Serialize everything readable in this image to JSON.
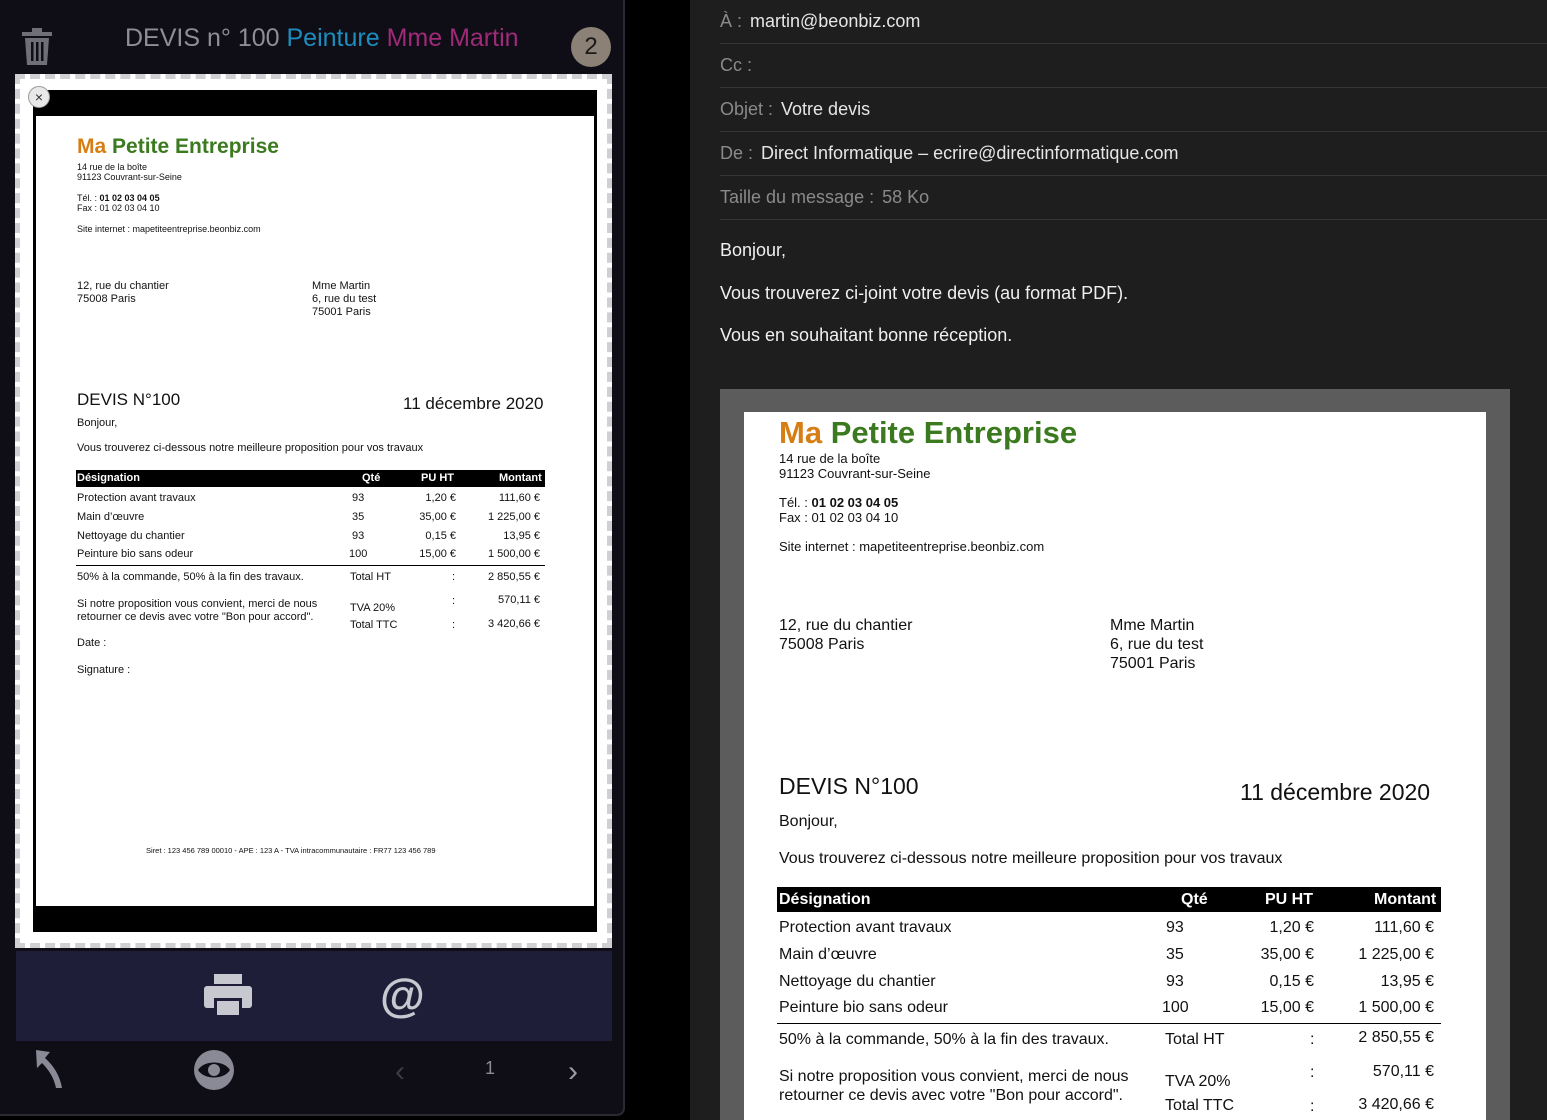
{
  "left": {
    "title_prefix": "DEVIS n° 100",
    "title_blue": "Peinture",
    "title_pink": "Mme Martin",
    "badge": "2",
    "close": "×",
    "page_number": "1",
    "at_symbol": "@"
  },
  "email": {
    "to_label": "À :",
    "to_value": "martin@beonbiz.com",
    "cc_label": "Cc :",
    "cc_value": "",
    "subject_label": "Objet :",
    "subject_value": "Votre devis",
    "from_label": "De :",
    "from_value": "Direct Informatique – ecrire@directinformatique.com",
    "size_label": "Taille du message :",
    "size_value": "58 Ko",
    "body": [
      "Bonjour,",
      "Vous trouverez ci-joint votre devis (au format PDF).",
      "Vous en souhaitant bonne réception."
    ]
  },
  "doc": {
    "brand_ma": "Ma",
    "brand_rest": "Petite Entreprise",
    "addr1": "14 rue de la boîte",
    "addr2": "91123 Couvrant-sur-Seine",
    "tel_label": "Tél. : ",
    "tel_value": "01 02 03 04 05",
    "fax": "Fax : 01 02 03 04 10",
    "site": "Site internet : mapetiteentreprise.beonbiz.com",
    "site_short": "Site internet : mapetiteentreprise.beonbiz.com",
    "chantier1": "12, rue du chantier",
    "chantier2": "75008 Paris",
    "client1": "Mme Martin",
    "client2": "6, rue du test",
    "client3": "75001 Paris",
    "devis_title": "DEVIS N°100",
    "date": "11 décembre 2020",
    "greeting": "Bonjour,",
    "intro": "Vous trouverez ci-dessous notre meilleure proposition pour vos travaux",
    "headers": [
      "Désignation",
      "Qté",
      "PU HT",
      "Montant"
    ],
    "rows": [
      [
        "Protection avant travaux",
        "93",
        "1,20 €",
        "111,60 €"
      ],
      [
        "Main d’œuvre",
        "35",
        "35,00 €",
        "1 225,00 €"
      ],
      [
        "Nettoyage du chantier",
        "93",
        "0,15 €",
        "13,95 €"
      ],
      [
        "Peinture bio sans odeur",
        "100",
        "15,00 €",
        "1 500,00 €"
      ]
    ],
    "terms": "50% à la commande, 50% à la fin des travaux.",
    "accept1": "Si notre proposition vous convient, merci de nous",
    "accept2": "retourner ce devis avec votre \"Bon pour accord\".",
    "total_ht_label": "Total HT",
    "total_ht": "2 850,55 €",
    "tva_label": "TVA 20%",
    "tva": "570,11 €",
    "ttc_label": "Total TTC",
    "ttc": "3 420,66 €",
    "colon": ":",
    "date_label": "Date :",
    "signature_label": "Signature :",
    "footer": "Siret : 123 456 789 00010 - APE : 123 A - TVA intracommunautaire : FR77 123 456 789"
  }
}
